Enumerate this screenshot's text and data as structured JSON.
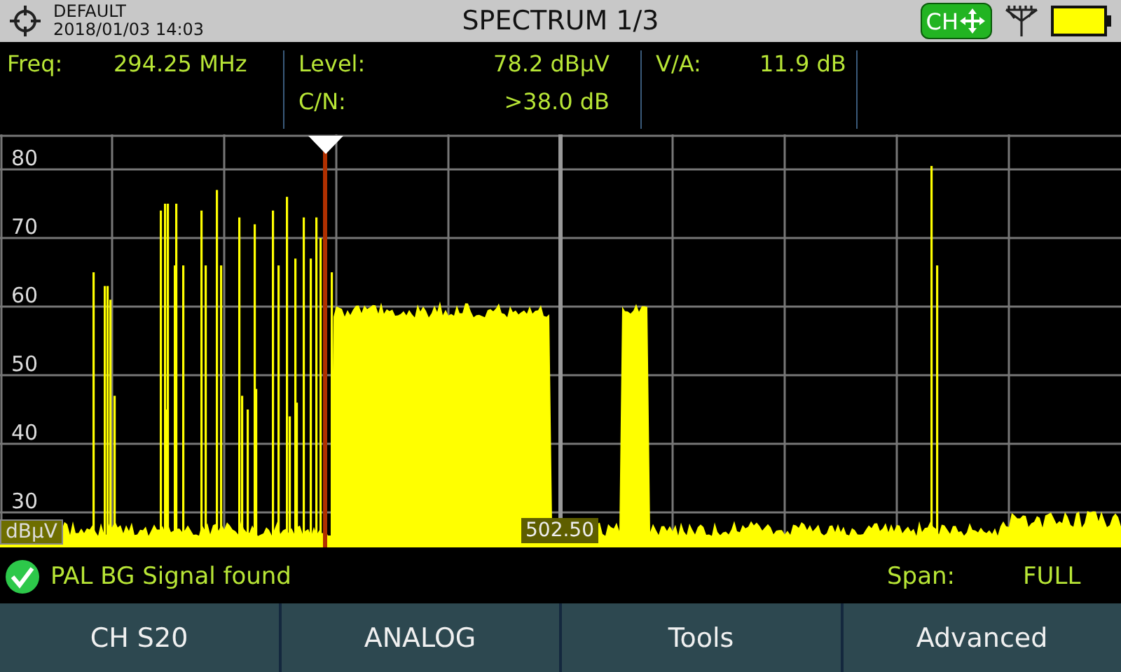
{
  "header": {
    "profile": "DEFAULT",
    "datetime": "2018/01/03 14:03",
    "title": "SPECTRUM 1/3",
    "mode_badge": "CH"
  },
  "measurements": [
    {
      "label": "Freq:",
      "value": "294.25 MHz"
    },
    {
      "label": "Level:",
      "value": "78.2 dBµV"
    },
    {
      "label": "C/N:",
      "value": ">38.0 dB"
    },
    {
      "label": "V/A:",
      "value": "11.9 dB"
    }
  ],
  "spectrum": {
    "y_labels": [
      "80",
      "70",
      "60",
      "50",
      "40",
      "30"
    ],
    "unit": "dBµV",
    "center_reading": "502.50"
  },
  "status": {
    "message": "PAL BG Signal found",
    "span_label": "Span:",
    "span_value": "FULL"
  },
  "buttons": [
    "CH S20",
    "ANALOG",
    "Tools",
    "Advanced"
  ]
}
